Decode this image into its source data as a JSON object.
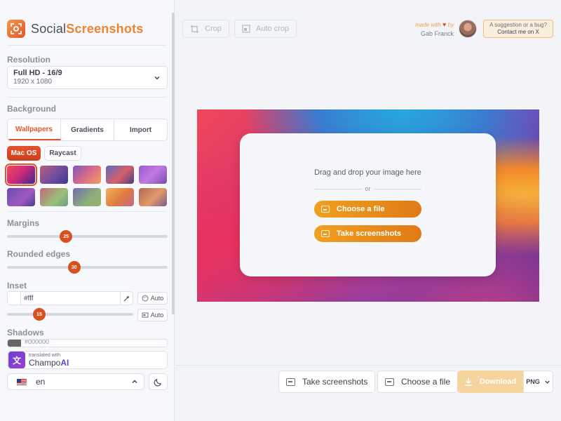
{
  "app": {
    "name_plain": "Social",
    "name_bold": "Screenshots"
  },
  "resolution": {
    "title": "Resolution",
    "value": "Full HD - 16/9",
    "size": "1920 x 1080"
  },
  "background": {
    "title": "Background",
    "tabs": [
      {
        "label": "Wallpapers",
        "active": true
      },
      {
        "label": "Gradients"
      },
      {
        "label": "Import"
      }
    ],
    "subtabs": [
      {
        "label": "Mac OS",
        "active": true
      },
      {
        "label": "Raycast"
      }
    ],
    "wallpapers": [
      {
        "name": "big-sur-red",
        "css": "linear-gradient(135deg,#f04b5c,#c7287a 50%,#3a2a90)"
      },
      {
        "name": "dusk-pink",
        "css": "linear-gradient(135deg,#b5607a,#6a4aa0 60%,#3b3a8a)"
      },
      {
        "name": "sunset-purple",
        "css": "linear-gradient(135deg,#7a5ac0,#d96a8a 50%,#f0a060)"
      },
      {
        "name": "mountain-blue",
        "css": "linear-gradient(135deg,#5a6ac0,#d6606a 55%,#4a3a80)"
      },
      {
        "name": "lavender",
        "css": "linear-gradient(135deg,#9a5ad0,#c07ae0 50%,#7a4ab0)"
      },
      {
        "name": "violet-wave",
        "css": "linear-gradient(135deg,#6a4ab0,#a05ac0 60%,#4a3a90)"
      },
      {
        "name": "hills-green",
        "css": "linear-gradient(135deg,#c06a7a,#9ac07a 60%,#6aa080)"
      },
      {
        "name": "meadow",
        "css": "linear-gradient(135deg,#7a6ab0,#8ab07a 60%,#a0b06a)"
      },
      {
        "name": "desert-orange",
        "css": "linear-gradient(135deg,#f0b060,#e07a40 55%,#c06a8a)"
      },
      {
        "name": "canyon",
        "css": "linear-gradient(135deg,#b06a5a,#e09a6a 55%,#7a5a8a)"
      }
    ]
  },
  "margins": {
    "title": "Margins",
    "value": "25",
    "level": 0.25
  },
  "rounded": {
    "title": "Rounded edges",
    "value": "30",
    "level": 0.3
  },
  "inset": {
    "title": "Inset",
    "color": "#fff",
    "auto": "Auto",
    "value": "15",
    "level": 0.15
  },
  "shadows": {
    "title": "Shadows",
    "color": "#000000"
  },
  "translated": {
    "small": "translated with",
    "brand_plain": "Champo",
    "brand_bold": "AI"
  },
  "language": {
    "code": "en"
  },
  "toolbar": {
    "crop": "Crop",
    "autocrop": "Auto crop"
  },
  "header": {
    "made_with": "made with",
    "by": "by",
    "author": "Gab Franck",
    "suggest_line1": "A suggestion or a bug?",
    "suggest_line2": "Contact me on X"
  },
  "dropzone": {
    "drag": "Drag and drop your image here",
    "or": "or",
    "choose": "Choose a file",
    "take": "Take screenshots"
  },
  "bottom": {
    "take": "Take screenshots",
    "choose": "Choose a file",
    "download": "Download",
    "format": "PNG"
  }
}
